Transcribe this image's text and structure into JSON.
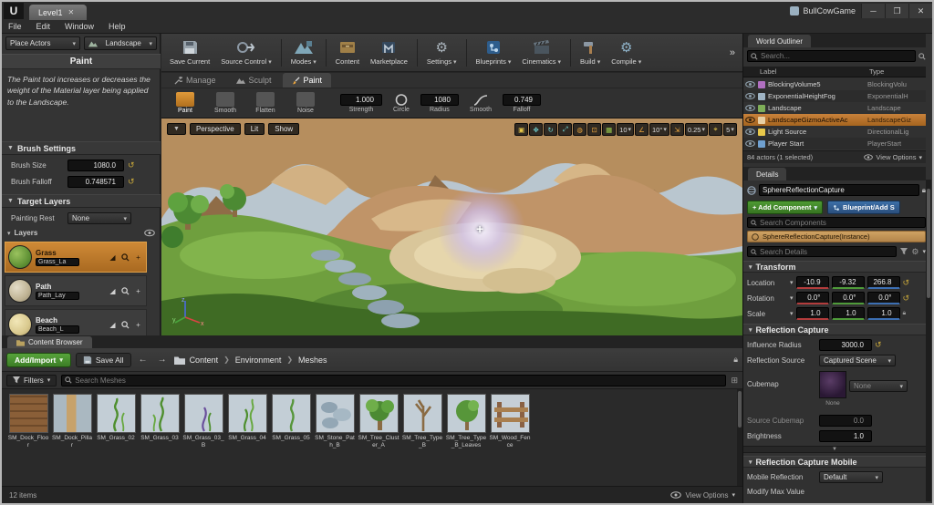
{
  "titlebar": {
    "logo": "U",
    "level_tab": "Level1",
    "app_title": "BullCowGame",
    "menus": [
      "File",
      "Edit",
      "Window",
      "Help"
    ],
    "win_min": "─",
    "win_max": "❐",
    "win_close": "✕"
  },
  "left_panel": {
    "place_actors_label": "Place Actors",
    "mode_label": "Landscape",
    "panel_title": "Paint",
    "description": "The Paint tool increases or decreases the weight of the Material layer being applied to the Landscape.",
    "brush_settings_title": "Brush Settings",
    "brush_size_label": "Brush Size",
    "brush_size_value": "1080.0",
    "brush_falloff_label": "Brush Falloff",
    "brush_falloff_value": "0.748571",
    "target_layers_title": "Target Layers",
    "painting_restriction_label": "Painting Rest",
    "painting_restriction_value": "None",
    "layers_title": "Layers",
    "layers": [
      {
        "name": "Grass",
        "field": "Grass_La"
      },
      {
        "name": "Path",
        "field": "Path_Lay"
      },
      {
        "name": "Beach",
        "field": "Beach_L"
      }
    ]
  },
  "main_toolbar": {
    "buttons": [
      "Save Current",
      "Source Control",
      "Modes",
      "Content",
      "Marketplace",
      "Settings",
      "Blueprints",
      "Cinematics",
      "Build",
      "Compile"
    ],
    "overflow": "»"
  },
  "landscape_panel": {
    "tabs": [
      "Manage",
      "Sculpt",
      "Paint"
    ],
    "tools": [
      "Paint",
      "Smooth",
      "Flatten",
      "Noise"
    ],
    "strength_value": "1.000",
    "strength_label": "Strength",
    "brush_shape_label": "Circle",
    "radius_value": "1080",
    "radius_label": "Radius",
    "falloff_shape_label": "Smooth",
    "falloff_value": "0.749",
    "falloff_label": "Falloff"
  },
  "viewport": {
    "camera_menu": "Perspective",
    "view_mode": "Lit",
    "show_menu": "Show",
    "grid_snap_value": "10",
    "rotation_snap_value": "10°",
    "scale_snap_value": "0.25",
    "camera_speed_value": "5",
    "axis_x": "x",
    "axis_y": "y",
    "axis_z": "z"
  },
  "world_outliner": {
    "tab_title": "World Outliner",
    "search_placeholder": "Search...",
    "col_label": "Label",
    "col_type": "Type",
    "rows": [
      {
        "label": "BlockingVolume5",
        "type": "BlockingVolu"
      },
      {
        "label": "ExponentialHeightFog",
        "type": "ExponentialH"
      },
      {
        "label": "Landscape",
        "type": "Landscape"
      },
      {
        "label": "LandscapeGizmoActiveAc",
        "type": "LandscapeGiz"
      },
      {
        "label": "Light Source",
        "type": "DirectionalLig"
      },
      {
        "label": "Player Start",
        "type": "PlayerStart"
      }
    ],
    "status": "84 actors (1 selected)",
    "view_options": "View Options"
  },
  "details": {
    "tab_title": "Details",
    "object_name": "SphereReflectionCapture",
    "add_component_label": "+ Add Component",
    "blueprint_label": "Blueprint/Add S",
    "search_components_placeholder": "Search Components",
    "instance_row": "SphereReflectionCapture(Instance)",
    "search_details_placeholder": "Search Details",
    "transform_title": "Transform",
    "location_label": "Location",
    "location": [
      "-10.9",
      "-9.32",
      "266.8"
    ],
    "rotation_label": "Rotation",
    "rotation": [
      "0.0°",
      "0.0°",
      "0.0°"
    ],
    "scale_label": "Scale",
    "scale": [
      "1.0",
      "1.0",
      "1.0"
    ],
    "reflection_title": "Reflection Capture",
    "influence_radius_label": "Influence Radius",
    "influence_radius_value": "3000.0",
    "reflection_source_label": "Reflection Source",
    "reflection_source_value": "Captured Scene",
    "cubemap_label": "Cubemap",
    "cubemap_value": "None",
    "source_cubemap_label": "Source Cubemap",
    "source_cubemap_value": "0.0",
    "brightness_label": "Brightness",
    "brightness_value": "1.0",
    "mobile_title": "Reflection Capture Mobile",
    "mobile_reflection_label": "Mobile Reflection",
    "mobile_reflection_value": "Default",
    "modify_max_label": "Modify Max Value"
  },
  "content_browser": {
    "tab_title": "Content Browser",
    "add_import_label": "Add/Import",
    "save_all_label": "Save All",
    "breadcrumb": [
      "Content",
      "Environment",
      "Meshes"
    ],
    "filters_label": "Filters",
    "search_placeholder": "Search Meshes",
    "assets": [
      "SM_Dock_Floor",
      "SM_Dock_Pillar",
      "SM_Grass_02",
      "SM_Grass_03",
      "SM_Grass_03_B",
      "SM_Grass_04",
      "SM_Grass_05",
      "SM_Stone_Path_B",
      "SM_Tree_Cluster_A",
      "SM_Tree_Type_B",
      "SM_Tree_Type_B_Leaves",
      "SM_Wood_Fence"
    ],
    "item_count": "12 items",
    "view_options": "View Options"
  },
  "colors": {
    "selection_orange": "#c8813a",
    "add_green": "#4e9a33",
    "blueprint_blue": "#3c6fa8"
  }
}
